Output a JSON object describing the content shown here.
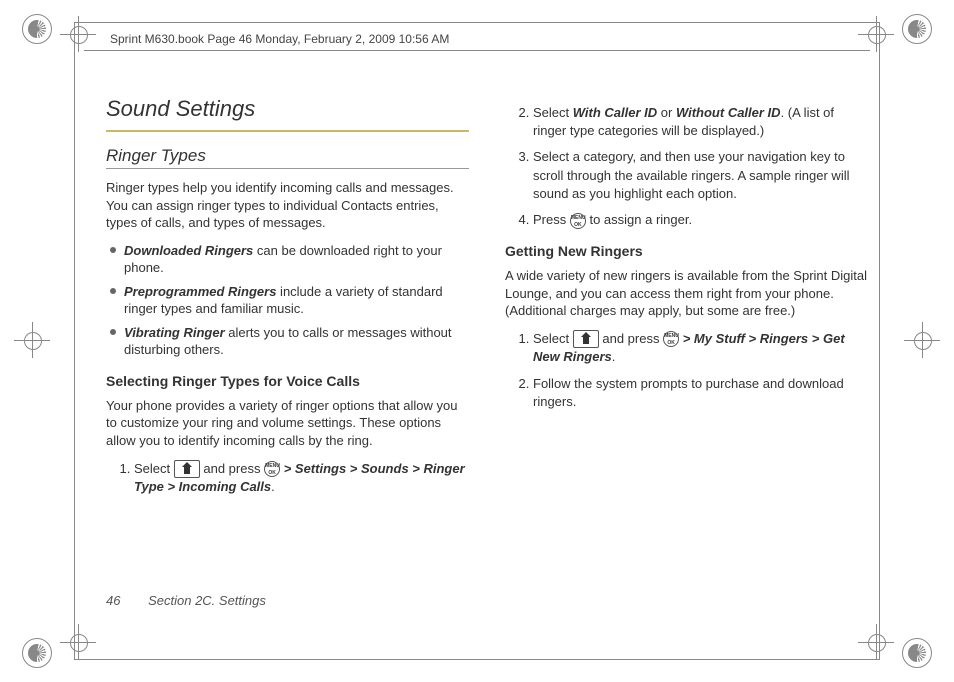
{
  "header_info": "Sprint M630.book  Page 46  Monday, February 2, 2009  10:56 AM",
  "section_title": "Sound Settings",
  "ringer_types": {
    "heading": "Ringer Types",
    "intro": "Ringer types help you identify incoming calls and messages. You can assign ringer types to individual Contacts entries, types of calls, and types of messages.",
    "bullets": [
      {
        "term": "Downloaded Ringers",
        "rest": " can be downloaded right to your phone."
      },
      {
        "term": "Preprogrammed Ringers",
        "rest": " include a variety of standard ringer types and familiar music."
      },
      {
        "term": "Vibrating Ringer",
        "rest": " alerts you to calls or messages without disturbing others."
      }
    ]
  },
  "selecting": {
    "heading": "Selecting Ringer Types for Voice Calls",
    "intro": "Your phone provides a variety of ringer options that allow you to customize your ring and volume settings. These options allow you to identify incoming calls by the ring.",
    "step1_pre": "Select ",
    "step1_mid": " and press ",
    "step1_path": " > Settings > Sounds > Ringer Type > Incoming Calls",
    "step1_end": ".",
    "step2_pre": "Select ",
    "step2_opt1": "With Caller ID",
    "step2_or": " or ",
    "step2_opt2": "Without Caller ID",
    "step2_end": ". (A list of ringer type categories will be displayed.)",
    "step3": "Select a category, and then use your navigation key to scroll through the available ringers. A sample ringer will sound as you highlight each option.",
    "step4_pre": "Press ",
    "step4_end": " to assign a ringer."
  },
  "getting": {
    "heading": "Getting New Ringers",
    "intro": "A wide variety of new ringers is available from the Sprint Digital Lounge, and you can access them right from your phone. (Additional charges may apply, but some are free.)",
    "step1_pre": "Select ",
    "step1_mid": " and press ",
    "step1_path": " > My Stuff > Ringers > Get New Ringers",
    "step1_end": ".",
    "step2": "Follow the system prompts to purchase and download ringers."
  },
  "footer": {
    "page_num": "46",
    "section": "Section 2C. Settings"
  }
}
